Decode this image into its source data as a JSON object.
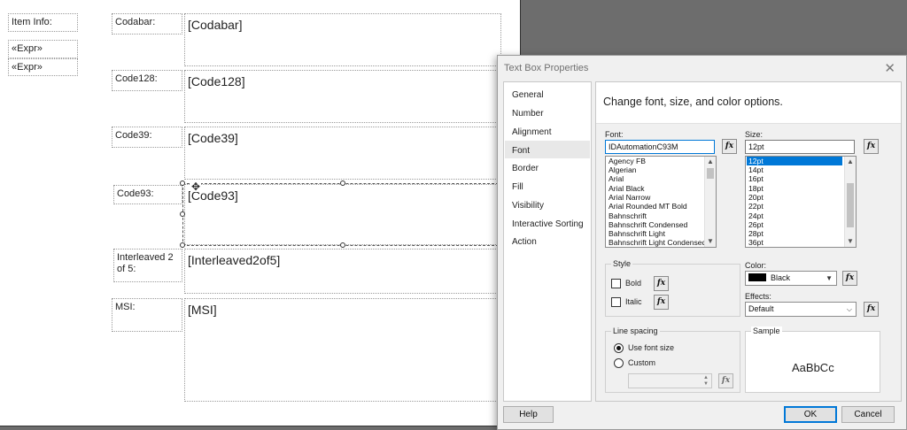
{
  "report": {
    "left_labels": {
      "item_info": "Item Info:",
      "expr1": "«Expr»",
      "expr2": "«Expr»"
    },
    "rows": [
      {
        "label": "Codabar:",
        "value": "[Codabar]"
      },
      {
        "label": "Code128:",
        "value": "[Code128]"
      },
      {
        "label": "Code39:",
        "value": "[Code39]"
      },
      {
        "label": "Code93:",
        "value": "[Code93]"
      },
      {
        "label": "Interleaved 2 of 5:",
        "value": "[Interleaved2of5]"
      },
      {
        "label": "MSI:",
        "value": "[MSI]"
      }
    ],
    "move_icon": "move-icon"
  },
  "dialog": {
    "title": "Text Box Properties",
    "close": "✕",
    "nav": [
      "General",
      "Number",
      "Alignment",
      "Font",
      "Border",
      "Fill",
      "Visibility",
      "Interactive Sorting",
      "Action"
    ],
    "active_nav": "Font",
    "header": "Change font, size, and color options.",
    "font": {
      "label": "Font:",
      "value": "IDAutomationC93M",
      "options": [
        "Agency FB",
        "Algerian",
        "Arial",
        "Arial Black",
        "Arial Narrow",
        "Arial Rounded MT Bold",
        "Bahnschrift",
        "Bahnschrift Condensed",
        "Bahnschrift Light",
        "Bahnschrift Light Condensed"
      ]
    },
    "size": {
      "label": "Size:",
      "value": "12pt",
      "options": [
        "12pt",
        "14pt",
        "16pt",
        "18pt",
        "20pt",
        "22pt",
        "24pt",
        "26pt",
        "28pt",
        "36pt"
      ],
      "selected": "12pt"
    },
    "fx_label": "fx",
    "style": {
      "title": "Style",
      "bold": "Bold",
      "italic": "Italic",
      "bold_checked": false,
      "italic_checked": false
    },
    "color": {
      "label": "Color:",
      "value": "Black",
      "swatch": "#000000"
    },
    "effects": {
      "label": "Effects:",
      "value": "Default"
    },
    "line_spacing": {
      "title": "Line spacing",
      "use_font_size": "Use font size",
      "custom": "Custom",
      "selected": "Use font size"
    },
    "sample": {
      "title": "Sample",
      "text": "AaBbCc"
    },
    "buttons": {
      "help": "Help",
      "ok": "OK",
      "cancel": "Cancel"
    }
  },
  "colors": {
    "background": "#6d6d6d",
    "accent": "#0078d7",
    "dialog_bg": "#f0f0f0"
  }
}
